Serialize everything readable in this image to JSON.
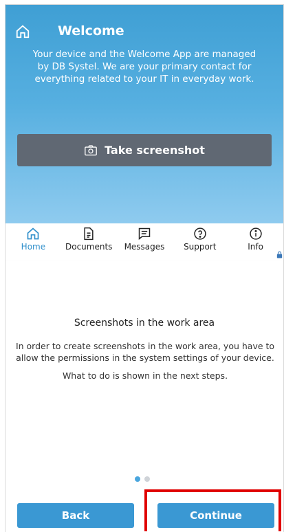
{
  "header": {
    "title": "Welcome",
    "intro": "Your device and the Welcome App are managed by DB Systel. We are your primary contact for everything related to your IT in everyday work.",
    "take_screenshot_label": "Take screenshot"
  },
  "nav": {
    "items": [
      {
        "label": "Home",
        "icon": "home-icon",
        "active": true
      },
      {
        "label": "Documents",
        "icon": "document-icon"
      },
      {
        "label": "Messages",
        "icon": "message-icon"
      },
      {
        "label": "Support",
        "icon": "help-icon"
      },
      {
        "label": "Info",
        "icon": "info-icon"
      }
    ]
  },
  "sheet": {
    "title": "Screenshots in the work area",
    "body": "In order to create screenshots in the work area, you have to allow the permissions in the system settings of your device.",
    "body2": "What to do is shown in the next steps.",
    "page_indicator": {
      "current": 1,
      "total": 2
    },
    "back_label": "Back",
    "continue_label": "Continue"
  },
  "colors": {
    "accent": "#3a98d3",
    "hero": "#4aa6de",
    "screenshot_button": "#606873",
    "highlight": "#e00000"
  }
}
